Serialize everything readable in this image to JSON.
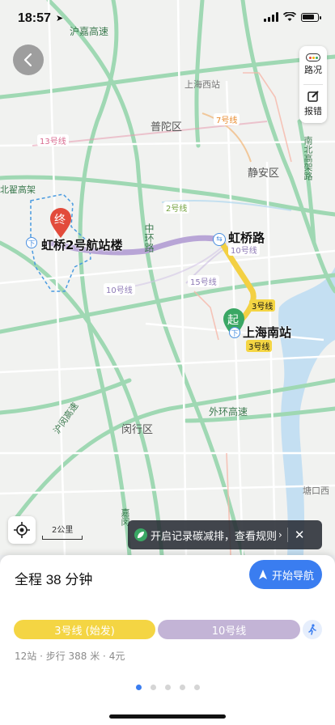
{
  "status_bar": {
    "time": "18:57"
  },
  "map": {
    "labels": {
      "hujia": "沪嘉高速",
      "shanghai_west": "上海西站",
      "putuo": "普陀区",
      "jingan": "静安区",
      "nanbei": "南北高架路",
      "beizhai": "北翟高架",
      "zhonghuan": "中环路",
      "minhang": "闵行区",
      "waihuan": "外环高速",
      "humin": "沪闵高速",
      "jiamin": "嘉闵",
      "tangkou": "塘口西",
      "hongqiao_terminal": "虹桥2号航站楼",
      "hongqiao_road": "虹桥路",
      "shanghai_south": "上海南站"
    },
    "line_tags": {
      "l13": "13号线",
      "l7": "7号线",
      "l2": "2号线",
      "l10a": "10号线",
      "l10b": "10号线",
      "l15": "15号线",
      "l3a": "3号线",
      "l3b": "3号线"
    },
    "markers": {
      "start": "起",
      "end": "终"
    },
    "scale": "2公里"
  },
  "side_tools": {
    "traffic": "路况",
    "report": "报错"
  },
  "carbon_tip": {
    "text": "开启记录碳减排，查看规则",
    "arrow": "›",
    "close": "✕"
  },
  "route": {
    "duration": "全程 38 分钟",
    "start_nav": "开始导航",
    "segments": [
      "3号线 (始发)",
      "10号线"
    ],
    "meta": "12站 · 步行 388 米 · 4元"
  },
  "colors": {
    "line3": "#f4d543",
    "line10": "#c3b4d6",
    "accent": "#3a7df0"
  }
}
